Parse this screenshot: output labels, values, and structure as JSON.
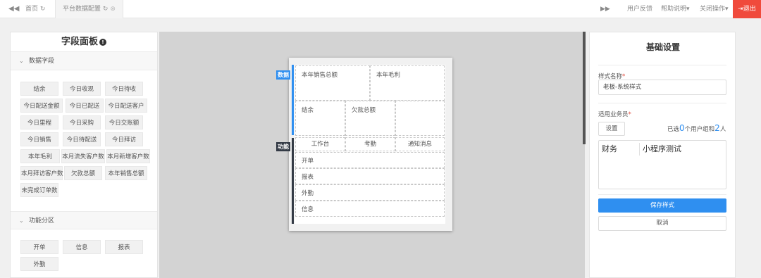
{
  "topbar": {
    "nav_back_icon": "double-chevron-left-icon",
    "home_tab": "首页",
    "config_tab": "平台数据配置",
    "nav_forward_icon": "double-chevron-right-icon",
    "feedback": "用户反馈",
    "help": "帮助说明",
    "close_ops": "关闭操作",
    "logout": "退出"
  },
  "field_panel": {
    "title": "字段面板",
    "data_section": "数据字段",
    "data_fields": [
      "结余",
      "今日收现",
      "今日待收",
      "今日配送金额",
      "今日已配送",
      "今日配送客户",
      "今日里程",
      "今日采购",
      "今日交账额",
      "今日销售",
      "今日待配送",
      "今日拜访",
      "本年毛利",
      "本月流失客户数",
      "本月新增客户数",
      "本月拜访客户数",
      "欠款总额",
      "本年销售总额",
      "未完成订单数"
    ],
    "function_section": "功能分区",
    "function_fields": [
      "开单",
      "信息",
      "报表",
      "外勤"
    ]
  },
  "preview": {
    "data_tag": "数据",
    "function_tag": "功能",
    "cells": [
      "本年销售总额",
      "本年毛利",
      "结余",
      "欠款总额",
      ""
    ],
    "function_tabs": [
      "工作台",
      "考勤",
      "通知消息"
    ],
    "function_rows": [
      "开单",
      "报表",
      "外勤",
      "信息"
    ]
  },
  "settings": {
    "title": "基础设置",
    "style_name_label": "样式名称",
    "style_name_value": "老板-系统样式",
    "salesman_label": "适用业务员",
    "set_button": "设置",
    "selected_prefix": "已选",
    "group_count": "0",
    "mid_text": "个用户组和",
    "user_count": "2",
    "suffix": "人",
    "members": [
      "财务",
      "小程序测试"
    ],
    "save_button": "保存样式",
    "cancel_button": "取消"
  },
  "colors": {
    "accent": "#2f8ff0",
    "logout": "#f04a3c",
    "dark_bar": "#333a45"
  }
}
